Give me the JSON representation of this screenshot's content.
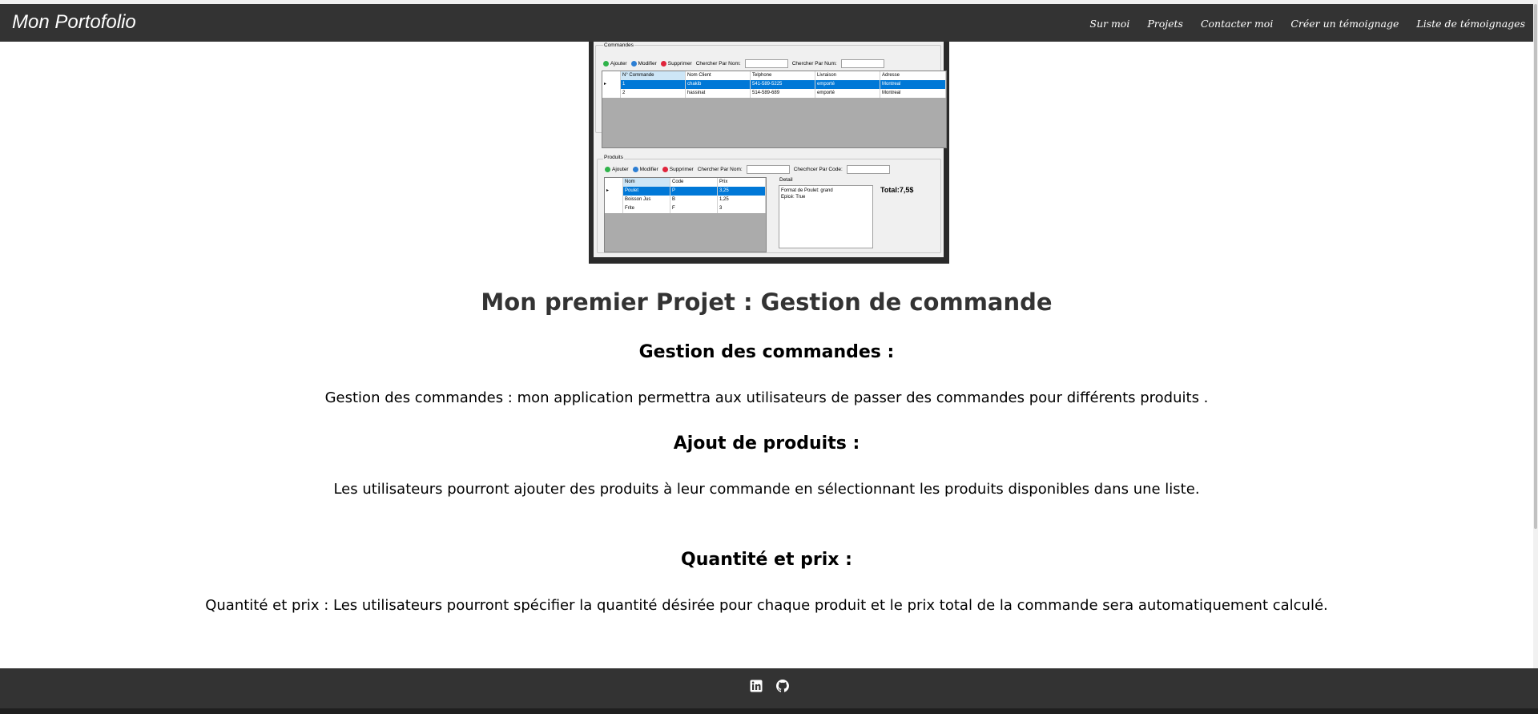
{
  "navbar": {
    "brand": "Mon Portofolio",
    "links": [
      "Sur moi",
      "Projets",
      "Contacter moi",
      "Créer un témoignage",
      "Liste de témoignages"
    ]
  },
  "screenshot": {
    "commandes": {
      "group_label": "Commandes",
      "toolbar": {
        "add": "Ajouter",
        "edit": "Modifier",
        "delete": "Supprimer",
        "search_name": "Chercher Par Nom:",
        "search_num": "Chercher Par Num:"
      },
      "headers": [
        "N° Commande",
        "Nom Client",
        "Telphone",
        "Livraison",
        "Adresse"
      ],
      "rows": [
        [
          "1",
          "chakib",
          "541-589-5225",
          "emporté",
          "Montreal"
        ],
        [
          "2",
          "hassinat",
          "514-589-689",
          "emporté",
          "Montreal"
        ]
      ]
    },
    "produits": {
      "group_label": "Produits",
      "toolbar": {
        "add": "Ajouter",
        "edit": "Modifier",
        "delete": "Supprimer",
        "search_name": "Chercher Par Nom:",
        "search_code": "Checrhcer Par Code:"
      },
      "headers": [
        "Nom",
        "Code",
        "Prix"
      ],
      "rows": [
        [
          "Poulet",
          "P",
          "3,25"
        ],
        [
          "Boisson Jus",
          "B",
          "1,25"
        ],
        [
          "Frite",
          "F",
          "3"
        ]
      ],
      "detail_label": "Detail",
      "detail_lines": [
        "Format de Poulet: grand",
        "Epicé: True"
      ],
      "total": "Total:7,5$"
    }
  },
  "main": {
    "title": "Mon premier Projet : Gestion de commande",
    "sections": [
      {
        "heading": "Gestion des commandes :",
        "text": "Gestion des commandes : mon application permettra aux utilisateurs de passer des commandes pour différents produits ."
      },
      {
        "heading": "Ajout de produits :",
        "text": "Les utilisateurs pourront ajouter des produits à leur commande en sélectionnant les produits disponibles dans une liste."
      },
      {
        "heading": "Quantité et prix :",
        "text": "Quantité et prix : Les utilisateurs pourront spécifier la quantité désirée pour chaque produit et le prix total de la commande sera automatiquement calculé."
      }
    ]
  },
  "footer": {
    "icons": [
      "linkedin-icon",
      "github-icon"
    ]
  },
  "colors": {
    "navbar_bg": "#333333",
    "selection": "#0078d7",
    "grid_bg": "#ababab"
  }
}
